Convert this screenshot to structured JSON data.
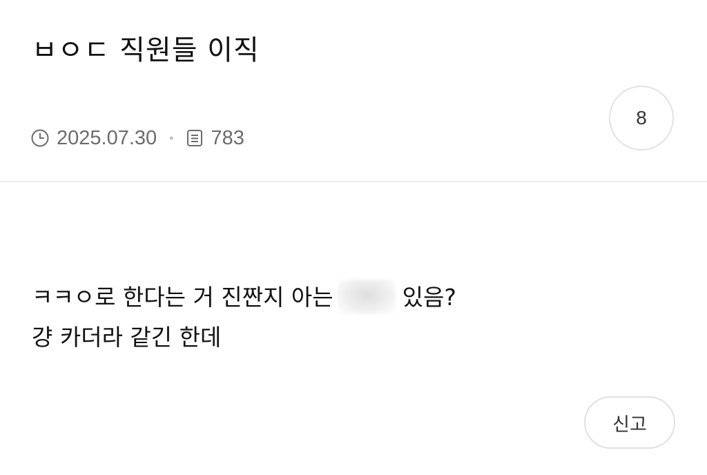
{
  "post": {
    "title": "ㅂㅇㄷ 직원들 이직",
    "date": "2025.07.30",
    "separator": "•",
    "views": "783",
    "comment_count": "8",
    "body_line1_before": "ㅋㅋㅇ로 한다는 거 진짠지 아는",
    "body_line1_after": "있음?",
    "body_line2": "걍 카더라 같긴 한데"
  },
  "actions": {
    "report_label": "신고"
  },
  "icons": {
    "date": "clock-icon",
    "views": "document-icon"
  },
  "colors": {
    "text": "#111111",
    "meta": "#6b6b6b",
    "border": "#e0e0e0"
  }
}
